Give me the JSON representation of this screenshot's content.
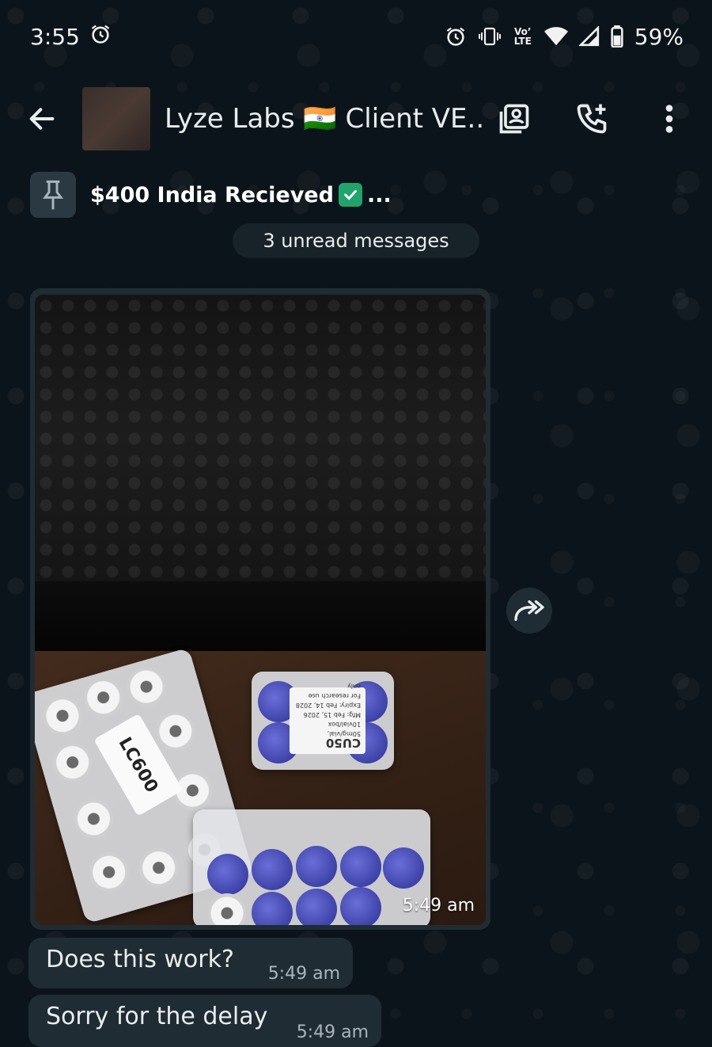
{
  "status_bar": {
    "time": "3:55",
    "network": "Vo’ LTE",
    "battery": "59%"
  },
  "header": {
    "title": "Lyze Labs 🇮🇳 Client VE...",
    "icons": [
      "back-arrow-icon",
      "contact-card-icon",
      "add-call-icon",
      "more-vert-icon"
    ]
  },
  "pinned": {
    "text": "$400 India Recieved",
    "suffix": "..."
  },
  "unread": {
    "label": "3 unread messages"
  },
  "messages": [
    {
      "type": "image",
      "time": "5:49 am",
      "labels": {
        "box_a": "LC600",
        "box_b_code": "CU50",
        "box_b_line1": "50mg/vial, 10vial/box",
        "box_b_line2": "Mfg: Feb 15, 2026",
        "box_b_line3": "Expiry: Feb 14, 2028",
        "box_b_line4": "For research use only"
      }
    },
    {
      "type": "text",
      "text": "Does this work?",
      "time": "5:49 am"
    },
    {
      "type": "text",
      "text": "Sorry for the delay",
      "time": "5:49 am"
    }
  ],
  "colors": {
    "background": "#0b141a",
    "bubble": "#202c33",
    "check": "#22a36b"
  }
}
